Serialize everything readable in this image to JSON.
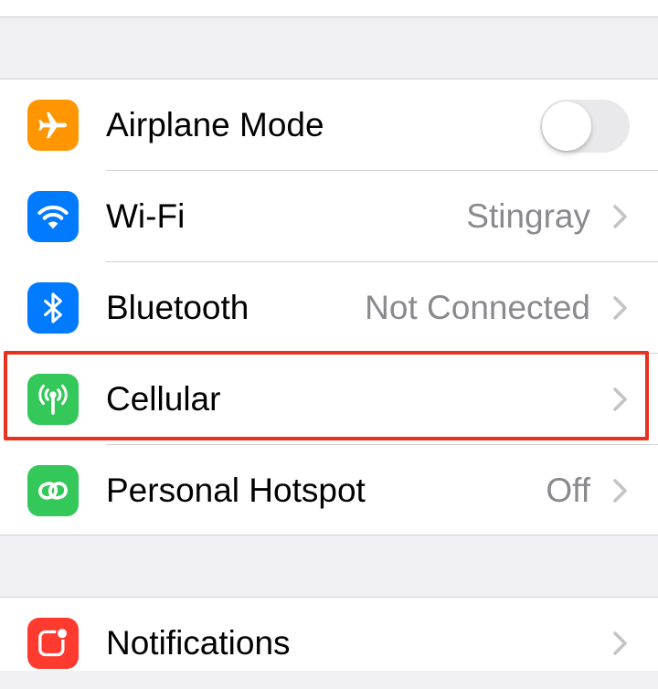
{
  "settings": {
    "airplane_mode": {
      "label": "Airplane Mode",
      "toggle_on": false,
      "icon": "airplane-icon",
      "icon_color": "#ff9500"
    },
    "wifi": {
      "label": "Wi-Fi",
      "value": "Stingray",
      "icon": "wifi-icon",
      "icon_color": "#007aff"
    },
    "bluetooth": {
      "label": "Bluetooth",
      "value": "Not Connected",
      "icon": "bluetooth-icon",
      "icon_color": "#007aff"
    },
    "cellular": {
      "label": "Cellular",
      "icon": "antenna-icon",
      "icon_color": "#34c759",
      "highlighted": true
    },
    "personal_hotspot": {
      "label": "Personal Hotspot",
      "value": "Off",
      "icon": "hotspot-link-icon",
      "icon_color": "#34c759"
    },
    "notifications": {
      "label": "Notifications",
      "icon": "notifications-icon",
      "icon_color": "#ff3b30"
    }
  },
  "colors": {
    "highlight_border": "#e8321e",
    "secondary_text": "#8a8a8e",
    "chevron": "#c4c4c7",
    "background": "#efeff4"
  }
}
